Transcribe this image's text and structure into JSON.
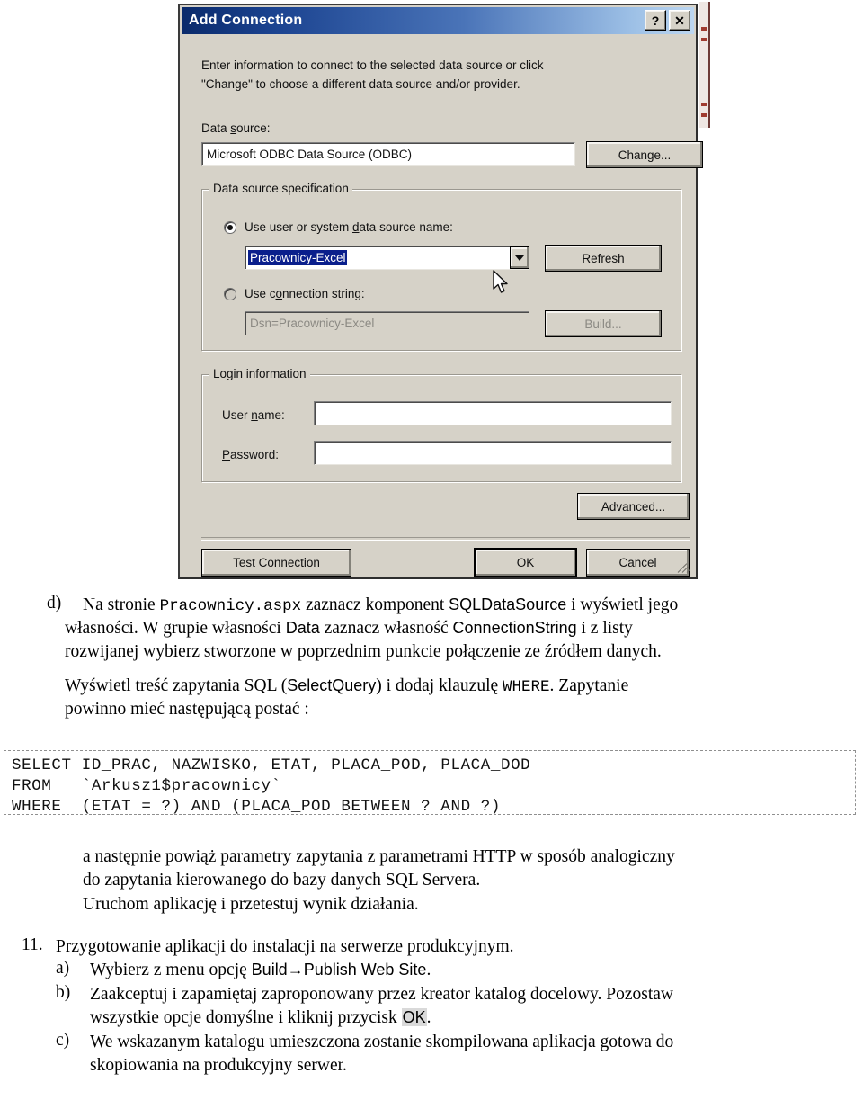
{
  "dialog": {
    "title": "Add Connection",
    "help_button": "?",
    "close_button": "✕",
    "intro_line1": "Enter information to connect to the selected data source or click",
    "intro_line2": "\"Change\" to choose a different data source and/or provider.",
    "data_source_label": "Data source:",
    "data_source_value": "Microsoft ODBC Data Source (ODBC)",
    "change_button": "Change...",
    "spec_group_title": "Data source specification",
    "radio_dsn_label": "Use user or system data source name:",
    "radio_dsn_selected": true,
    "dsn_combo_value": "Pracownicy-Excel",
    "refresh_button": "Refresh",
    "radio_connstr_label": "Use connection string:",
    "radio_connstr_selected": false,
    "connstr_value": "Dsn=Pracownicy-Excel",
    "build_button": "Build...",
    "login_group_title": "Login information",
    "username_label": "User name:",
    "username_value": "",
    "password_label": "Password:",
    "password_value": "",
    "advanced_button": "Advanced...",
    "test_connection_button": "Test Connection",
    "ok_button": "OK",
    "cancel_button": "Cancel"
  },
  "document": {
    "item_d": {
      "marker": "d)",
      "line1_a": "Na stronie ",
      "line1_mono": "Pracownicy.aspx",
      "line1_b": " zaznacz komponent ",
      "line1_sans": "SQLDataSource",
      "line1_c": " i wyświetl jego",
      "line2_a": "własności. W grupie własności ",
      "line2_sans1": "Data",
      "line2_b": " zaznacz własność ",
      "line2_sans2": "ConnectionString",
      "line2_c": " i z listy",
      "line3": "rozwijanej wybierz stworzone w poprzednim punkcie połączenie ze źródłem danych.",
      "line4_a": "Wyświetl treść zapytania SQL (",
      "line4_sans": "SelectQuery",
      "line4_b": ") i dodaj klauzulę ",
      "line4_mono": "WHERE",
      "line4_c": ". Zapytanie",
      "line5": "powinno mieć następującą postać :"
    },
    "sql": {
      "line1": "SELECT ID_PRAC, NAZWISKO, ETAT, PLACA_POD, PLACA_DOD",
      "line2": "FROM   `Arkusz1$pracownicy`",
      "line3": "WHERE  (ETAT = ?) AND (PLACA_POD BETWEEN ? AND ?)"
    },
    "after_sql": {
      "line1": "a następnie powiąż parametry zapytania z parametrami HTTP w sposób analogiczny",
      "line2": "do zapytania kierowanego do bazy danych SQL Servera.",
      "line3": "Uruchom aplikację i przetestuj wynik działania."
    },
    "item_11": {
      "marker": "11.",
      "text": "Przygotowanie aplikacji do instalacji na serwerze produkcyjnym."
    },
    "item_a": {
      "marker": "a)",
      "text_a": "Wybierz z menu opcję ",
      "text_sans": "Build→Publish Web Site",
      "text_b": "."
    },
    "item_b": {
      "marker": "b)",
      "line1": "Zaakceptuj i zapamiętaj zaproponowany przez kreator katalog docelowy. Pozostaw",
      "line2_a": "wszystkie opcje domyślne i kliknij przycisk ",
      "line2_ok": "OK",
      "line2_b": "."
    },
    "item_c": {
      "marker": "c)",
      "line1": "We wskazanym katalogu umieszczona zostanie skompilowana aplikacja gotowa do",
      "line2": "skopiowania na produkcyjny serwer."
    }
  },
  "colors": {
    "titlebar_start": "#0a2a6b",
    "titlebar_end": "#bcd6f0",
    "dialog_face": "#d6d2c8",
    "selection_blue": "#0a1f8c"
  }
}
